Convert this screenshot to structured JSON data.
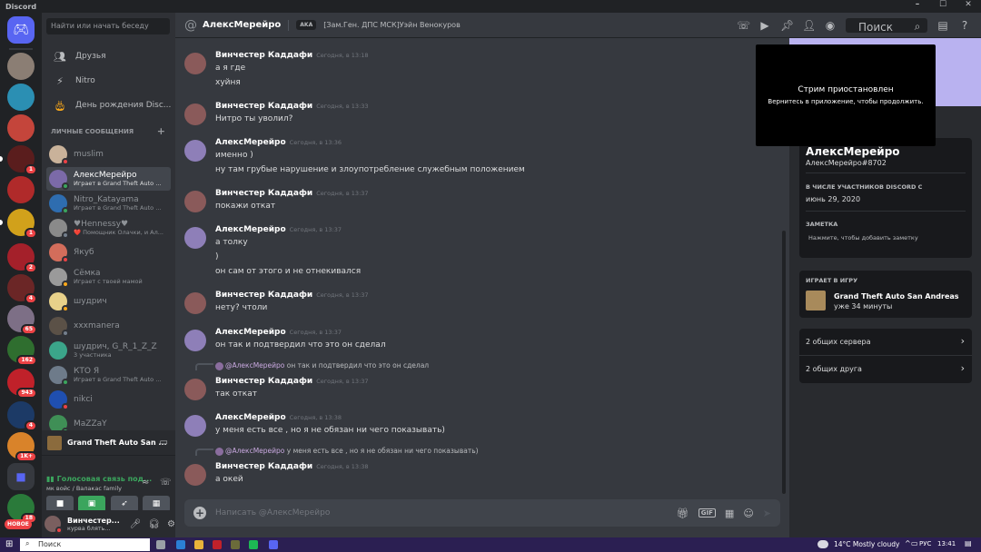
{
  "window": {
    "title": "Discord",
    "controls": [
      "–",
      "☐",
      "✕"
    ]
  },
  "servers": {
    "badges": [
      "1",
      "1",
      "2",
      "4",
      "65",
      "162",
      "943",
      "4",
      "1K+",
      "18"
    ],
    "new_label": "НОВОЕ"
  },
  "dm": {
    "search_placeholder": "Найти или начать беседу",
    "nav": [
      {
        "label": "Друзья",
        "icon": "friends-icon"
      },
      {
        "label": "Nitro",
        "icon": "nitro-icon"
      },
      {
        "label": "День рождения Disc...",
        "icon": "birthday-icon"
      }
    ],
    "header": "ЛИЧНЫЕ СООБЩЕНИЯ",
    "list": [
      {
        "name": "muslim",
        "sub": "",
        "status": "#ed4245",
        "color": "#c9b29a"
      },
      {
        "name": "АлексМерейро",
        "sub": "Играет в Grand Theft Auto San Andreas",
        "status": "#3ba55d",
        "color": "#7b6aa8"
      },
      {
        "name": "Nitro_Katayama",
        "sub": "Играет в Grand Theft Auto San Andreas",
        "status": "#3ba55d",
        "color": "#2e6db0"
      },
      {
        "name": "♥Hennessy♥",
        "sub": "❤️ Помощник Олачки, и Ал...",
        "status": "#747f8d",
        "color": "#8a8a8a"
      },
      {
        "name": "Якуб",
        "sub": "",
        "status": "#ed4245",
        "color": "#d36d5b"
      },
      {
        "name": "Сёмка",
        "sub": "Играет с твоей мамой",
        "status": "#faa81a",
        "color": "#9a9a9a"
      },
      {
        "name": "шудрич",
        "sub": "",
        "status": "#faa81a",
        "color": "#e8d18a"
      },
      {
        "name": "xxxmanera",
        "sub": "",
        "status": "#747f8d",
        "color": "#5b5147"
      },
      {
        "name": "шудрич, G_R_1_Z_Z",
        "sub": "3 участника",
        "status": "",
        "color": "#3ba58a"
      },
      {
        "name": "КТО Я",
        "sub": "Играет в Grand Theft Auto San Andreas",
        "status": "#3ba55d",
        "color": "#6e7b8a"
      },
      {
        "name": "nikci",
        "sub": "",
        "status": "#ed4245",
        "color": "#1f4fb0"
      },
      {
        "name": "MaZZaY",
        "sub": "",
        "status": "#3ba55d",
        "color": "#3f8f56"
      }
    ],
    "game_activity": "Grand Theft Auto San ...",
    "voice": {
      "status": "Голосовая связь под...",
      "channel": "мк войс / Валакас family"
    },
    "user": {
      "name": "Винчестер...",
      "status": "курва блять..."
    }
  },
  "chat": {
    "recipient": "АлексМерейро",
    "aka_label": "AKA",
    "aka_value": "[Зам.Ген. ДПС МСК]Уэйн Венокуров",
    "search_placeholder": "Поиск",
    "composer_placeholder": "Написать @АлексМерейро",
    "messages": [
      {
        "author": "Винчестер Каддафи",
        "time": "Сегодня, в 13:18",
        "lines": [
          "а я где",
          "хуйня"
        ],
        "reply": null
      },
      {
        "author": "Винчестер Каддафи",
        "time": "Сегодня, в 13:33",
        "lines": [
          "Нитро ты уволил?"
        ],
        "reply": null
      },
      {
        "author": "АлексМерейро",
        "time": "Сегодня, в 13:36",
        "lines": [
          "именно )",
          "ну там грубые нарушение и злоупотребление служебным положением"
        ],
        "reply": null
      },
      {
        "author": "Винчестер Каддафи",
        "time": "Сегодня, в 13:37",
        "lines": [
          "покажи откат"
        ],
        "reply": null
      },
      {
        "author": "АлексМерейро",
        "time": "Сегодня, в 13:37",
        "lines": [
          "а толку",
          ")",
          "он сам от этого и не отнекивался"
        ],
        "reply": null
      },
      {
        "author": "Винчестер Каддафи",
        "time": "Сегодня, в 13:37",
        "lines": [
          "нету? чтоли"
        ],
        "reply": null
      },
      {
        "author": "АлексМерейро",
        "time": "Сегодня, в 13:37",
        "lines": [
          "он так и подтвердил что это он сделал"
        ],
        "reply": null
      },
      {
        "author": "Винчестер Каддафи",
        "time": "Сегодня, в 13:37",
        "lines": [
          "так откат"
        ],
        "reply": {
          "author": "@АлексМерейро",
          "text": "он так и подтвердил что это он сделал"
        }
      },
      {
        "author": "АлексМерейро",
        "time": "Сегодня, в 13:38",
        "lines": [
          "у меня есть все , но я не обязан ни чего показывать)"
        ],
        "reply": null
      },
      {
        "author": "Винчестер Каддафи",
        "time": "Сегодня, в 13:38",
        "lines": [
          "а окей"
        ],
        "reply": {
          "author": "@АлексМерейро",
          "text": "у меня есть все , но я не обязан ни чего показывать)"
        }
      }
    ]
  },
  "profile": {
    "name": "АлексМерейро",
    "tag": "АлексМерейро#8702",
    "member_since_label": "В ЧИСЛЕ УЧАСТНИКОВ DISCORD С",
    "member_since": "июнь 29, 2020",
    "note_label": "ЗАМЕТКА",
    "note_placeholder": "Нажмите, чтобы добавить заметку",
    "playing_label": "ИГРАЕТ В ИГРУ",
    "game": "Grand Theft Auto San Andreas",
    "game_time": "уже 34 минуты",
    "mutual_servers": "2 общих сервера",
    "mutual_friends": "2 общих друга"
  },
  "stream": {
    "title": "Стрим приостановлен",
    "text": "Вернитесь в приложение, чтобы продолжить."
  },
  "taskbar": {
    "search": "Поиск",
    "weather": "14°C  Mostly cloudy",
    "lang": "РУС",
    "time": "13:41"
  }
}
